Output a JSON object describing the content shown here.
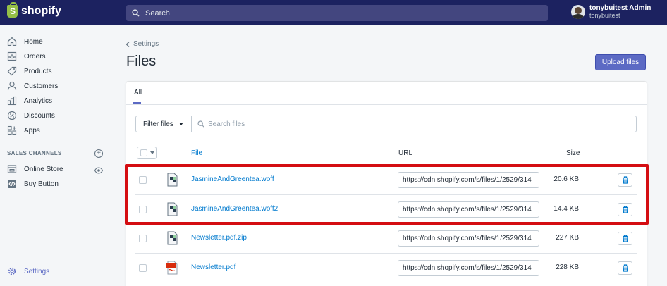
{
  "topbar": {
    "brand": "shopify",
    "search_placeholder": "Search",
    "user_name": "tonybuitest Admin",
    "user_store": "tonybuitest"
  },
  "sidebar": {
    "items": [
      {
        "label": "Home",
        "icon": "home-icon"
      },
      {
        "label": "Orders",
        "icon": "orders-icon"
      },
      {
        "label": "Products",
        "icon": "tag-icon"
      },
      {
        "label": "Customers",
        "icon": "person-icon"
      },
      {
        "label": "Analytics",
        "icon": "bar-chart-icon"
      },
      {
        "label": "Discounts",
        "icon": "discount-icon"
      },
      {
        "label": "Apps",
        "icon": "apps-icon"
      }
    ],
    "channels_title": "SALES CHANNELS",
    "channels": [
      {
        "label": "Online Store",
        "icon": "store-icon"
      },
      {
        "label": "Buy Button",
        "icon": "code-icon"
      }
    ],
    "settings_label": "Settings"
  },
  "main": {
    "breadcrumb": "Settings",
    "title": "Files",
    "upload_label": "Upload files",
    "tab_all": "All",
    "filter_label": "Filter files",
    "search_placeholder": "Search files",
    "columns": {
      "file": "File",
      "url": "URL",
      "size": "Size"
    },
    "files": [
      {
        "name": "JasmineAndGreentea.woff",
        "url": "https://cdn.shopify.com/s/files/1/2529/314",
        "size": "20.6 KB",
        "type": "generic"
      },
      {
        "name": "JasmineAndGreentea.woff2",
        "url": "https://cdn.shopify.com/s/files/1/2529/314",
        "size": "14.4 KB",
        "type": "generic"
      },
      {
        "name": "Newsletter.pdf.zip",
        "url": "https://cdn.shopify.com/s/files/1/2529/314",
        "size": "227 KB",
        "type": "generic"
      },
      {
        "name": "Newsletter.pdf",
        "url": "https://cdn.shopify.com/s/files/1/2529/314",
        "size": "228 KB",
        "type": "pdf"
      }
    ]
  },
  "colors": {
    "topbar": "#1c2260",
    "accent": "#5c6ac4",
    "link": "#007ace",
    "highlight": "#d40d12"
  }
}
